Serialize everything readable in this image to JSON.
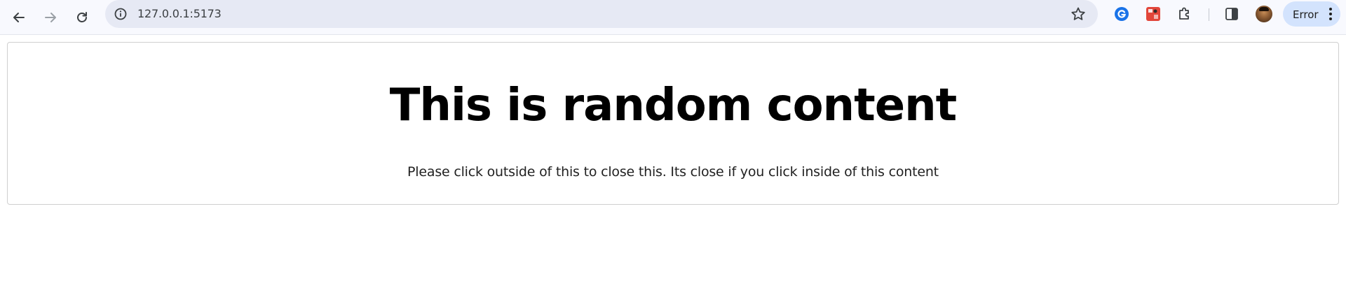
{
  "browser": {
    "url": "127.0.0.1:5173",
    "profile_status": "Error",
    "icons": {
      "back": "arrow-left-icon",
      "forward": "arrow-right-icon",
      "reload": "reload-icon",
      "site_info": "info-icon",
      "bookmark": "star-icon",
      "extension_1": "grammarly-icon",
      "extension_2": "screen-capture-icon",
      "extensions": "puzzle-icon",
      "side_panel": "side-panel-icon",
      "menu": "kebab-menu-icon"
    },
    "colors": {
      "toolbar_bg": "#f8f9fe",
      "omnibox_bg": "#e6e9f4",
      "error_chip_bg": "#d3e3fd"
    }
  },
  "page": {
    "heading": "This is random content",
    "description": "Please click outside of this to close this. Its close if you click inside of this content"
  }
}
